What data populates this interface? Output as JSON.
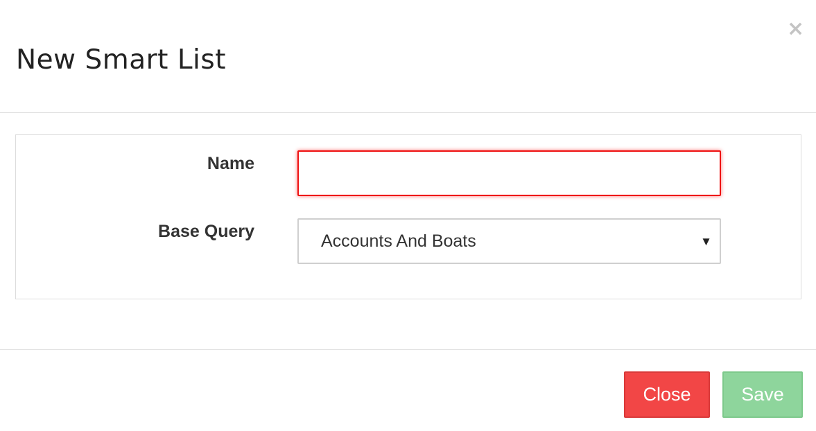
{
  "dialog": {
    "title": "New Smart List",
    "close_icon": "close-icon",
    "close_glyph": "×"
  },
  "form": {
    "name_label": "Name",
    "name_value": "",
    "name_state": "error",
    "base_query_label": "Base Query",
    "base_query_selected": "Accounts And Boats",
    "dropdown_icon": "caret-down-icon",
    "dropdown_glyph": "▼"
  },
  "footer": {
    "close_label": "Close",
    "save_label": "Save",
    "save_enabled": false
  },
  "colors": {
    "close_button": "#f24646",
    "save_button_disabled": "#8ed59c",
    "error_border": "#ee1111"
  }
}
